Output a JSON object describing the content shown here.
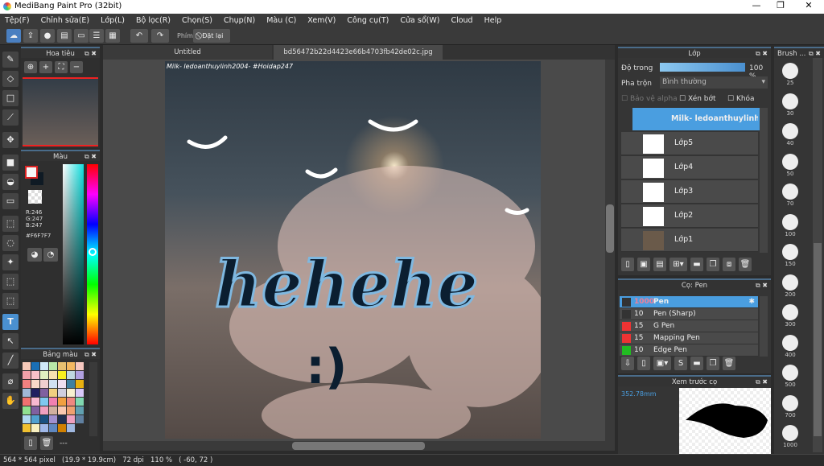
{
  "window": {
    "title": "MediBang Paint Pro (32bit)",
    "controls": [
      "—",
      "❐",
      "✕"
    ]
  },
  "menu": [
    "Tệp(F)",
    "Chỉnh sửa(E)",
    "Lớp(L)",
    "Bộ lọc(R)",
    "Chọn(S)",
    "Chụp(N)",
    "Màu (C)",
    "Xem(V)",
    "Công cụ(T)",
    "Cửa sổ(W)",
    "Cloud",
    "Help"
  ],
  "toolbar": {
    "phim_label": "Phím",
    "reset_label": "Đặt lại"
  },
  "tabs": [
    "Untitled",
    "bd56472b22d4423e66b4703fb42de02c.jpg"
  ],
  "canvas": {
    "watermark": "Milk- ledoanthuylinh2004- #Hoidap247",
    "art_text": "hehehe",
    "smiley": ":)"
  },
  "navigator": {
    "title": "Hoa tiêu"
  },
  "color": {
    "title": "Màu",
    "r": "R:246",
    "g": "G:247",
    "b": "B:247",
    "hex": "#F6F7F7",
    "fg": "#F6F7F7",
    "bg": "#0f1a24"
  },
  "palette": {
    "title": "Bảng màu",
    "sep": "---",
    "colors": [
      "#f5c9b8",
      "#1a6fb5",
      "#cfe8f7",
      "#b8e8a8",
      "#e8c070",
      "#f4b860",
      "#f7c8c0",
      "#f0a0a8",
      "#f7c0c8",
      "#e0f0c0",
      "#f7e0b0",
      "#f7f020",
      "#c0d8e0",
      "#b0a0e0",
      "#f08080",
      "#f7d8c8",
      "#f0d0d0",
      "#d0e0f0",
      "#f0e0f0",
      "#4080a0",
      "#e8b010",
      "#a0b8d8",
      "#202060",
      "#8060a0",
      "#f0d080",
      "#d0d0e0",
      "#f8f0d0",
      "#d8c8f8",
      "#f07070",
      "#f8b8d0",
      "#80c8f0",
      "#f080b0",
      "#f0a040",
      "#f08880",
      "#80d8b0",
      "#90e090",
      "#8060a0",
      "#f0a0c0",
      "#d0b0a0",
      "#f8c8b0",
      "#f0a070",
      "#60a0b0",
      "#b0d8f0",
      "#50a0d0",
      "#1a5080",
      "#a090d0",
      "#203050",
      "#f0a0c0",
      "#6080a0",
      "#f0c030",
      "#f8f0c0",
      "#a0b8e8",
      "#6088c0",
      "#d08000",
      "#a0b8e0"
    ]
  },
  "layers": {
    "title": "Lớp",
    "opacity_label": "Độ trong",
    "opacity_value": "100 %",
    "opacity": 100,
    "blend_label": "Pha trộn",
    "blend_value": "Bình thường",
    "protect_alpha": "Bảo vệ alpha",
    "clip": "Xén bớt",
    "lock": "Khóa",
    "items": [
      {
        "name": "Milk- ledoanthuylinh2004- #Hoidap247",
        "selected": true
      },
      {
        "name": "Lớp5"
      },
      {
        "name": "Lớp4"
      },
      {
        "name": "Lớp3"
      },
      {
        "name": "Lớp2"
      },
      {
        "name": "Lớp1"
      }
    ]
  },
  "brush_panel": {
    "title": "Cọ: Pen",
    "items": [
      {
        "size": "1000",
        "name": "Pen",
        "color": "#333333",
        "selected": true
      },
      {
        "size": "10",
        "name": "Pen (Sharp)",
        "color": "#333333"
      },
      {
        "size": "15",
        "name": "G Pen",
        "color": "#ee3333"
      },
      {
        "size": "15",
        "name": "Mapping Pen",
        "color": "#ee3333"
      },
      {
        "size": "10",
        "name": "Edge Pen",
        "color": "#22bb22"
      }
    ]
  },
  "brush_preview": {
    "title": "Xem trước cọ",
    "size": "352.78mm"
  },
  "brush_size": {
    "title": "Brush ...",
    "sizes": [
      "25",
      "30",
      "40",
      "50",
      "70",
      "100",
      "150",
      "200",
      "300",
      "400",
      "500",
      "700",
      "1000"
    ]
  },
  "status": {
    "dimensions": "564 * 564 pixel",
    "physical": "(19.9 * 19.9cm)",
    "dpi": "72 dpi",
    "zoom": "110 %",
    "coords": "( -60, 72 )"
  }
}
